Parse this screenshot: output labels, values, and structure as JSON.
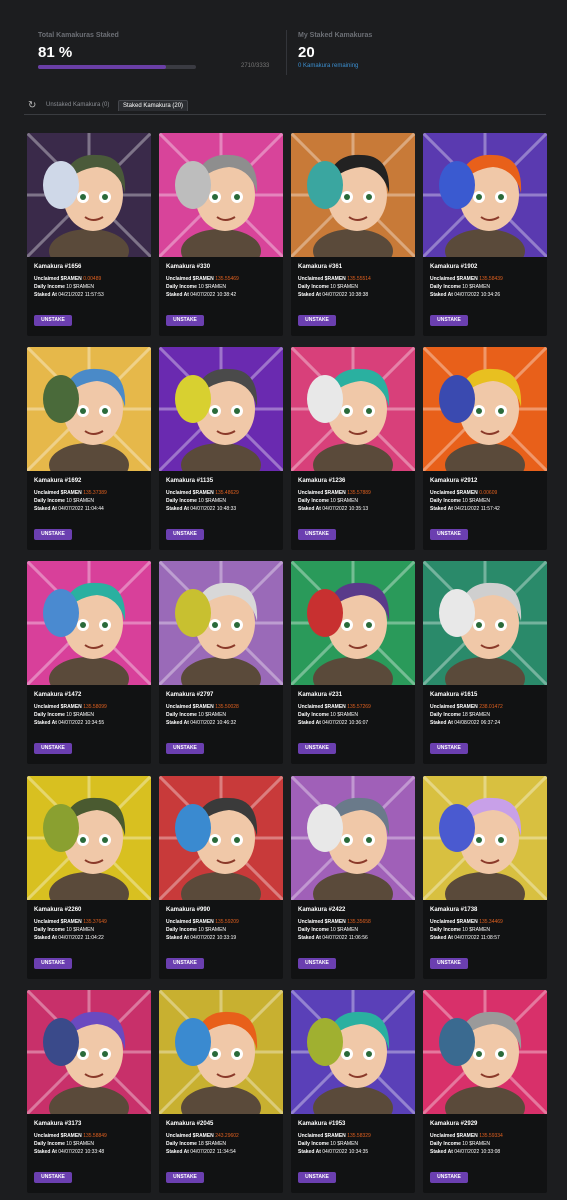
{
  "stats": {
    "total_label": "Total Kamakuras Staked",
    "total_percent": "81 %",
    "progress_fraction": 0.81,
    "progress_count": "2710/3333",
    "my_label": "My Staked Kamakuras",
    "my_count": "20",
    "remaining": "0 Kamakura remaining"
  },
  "tabs": {
    "refresh_icon": "refresh-icon",
    "unstaked": "Unstaked Kamakura (0)",
    "staked": "Staked Kamakura (20)"
  },
  "labels": {
    "unclaimed": "Unclaimed $RAMEN",
    "daily": "Daily Income",
    "staked_at": "Staked At",
    "button": "UNSTAKE"
  },
  "colors": {
    "accent_purple": "#6b3fb0",
    "value_orange": "#e0601f",
    "link_blue": "#3b8fd0"
  },
  "cards": [
    {
      "name": "Kamakura #1656",
      "unclaimed": "0.00489",
      "daily": "10 $RAMEN",
      "staked": "04/21/2022 11:57:53",
      "bg": "#3a2a4a",
      "mask": "#cfd8e8",
      "hair": "#4a5a3a"
    },
    {
      "name": "Kamakura #330",
      "unclaimed": "135.55469",
      "daily": "10 $RAMEN",
      "staked": "04/07/2022 10:38:42",
      "bg": "#d8449a",
      "mask": "#bdbdbd",
      "hair": "#8e8e8e"
    },
    {
      "name": "Kamakura #361",
      "unclaimed": "135.55514",
      "daily": "10 $RAMEN",
      "staked": "04/07/2022 10:38:38",
      "bg": "#c87a38",
      "mask": "#3aa6a0",
      "hair": "#222222"
    },
    {
      "name": "Kamakura #1902",
      "unclaimed": "135.58439",
      "daily": "10 $RAMEN",
      "staked": "04/07/2022 10:34:26",
      "bg": "#5a3ab0",
      "mask": "#3a5ad0",
      "hair": "#e8601a"
    },
    {
      "name": "Kamakura #1692",
      "unclaimed": "135.37389",
      "daily": "10 $RAMEN",
      "staked": "04/07/2022 11:04:44",
      "bg": "#e6b84a",
      "mask": "#4a6a3a",
      "hair": "#4a8ac8"
    },
    {
      "name": "Kamakura #1135",
      "unclaimed": "135.48629",
      "daily": "10 $RAMEN",
      "staked": "04/07/2022 10:48:33",
      "bg": "#6a2ab0",
      "mask": "#d8d030",
      "hair": "#4a4a4a"
    },
    {
      "name": "Kamakura #1236",
      "unclaimed": "135.57889",
      "daily": "10 $RAMEN",
      "staked": "04/07/2022 10:35:13",
      "bg": "#d8407a",
      "mask": "#e8e8e8",
      "hair": "#2ab0a0"
    },
    {
      "name": "Kamakura #2912",
      "unclaimed": "0.00609",
      "daily": "10 $RAMEN",
      "staked": "04/21/2022 11:57:42",
      "bg": "#e8601a",
      "mask": "#3a4ab0",
      "hair": "#e8c020"
    },
    {
      "name": "Kamakura #1472",
      "unclaimed": "135.58099",
      "daily": "10 $RAMEN",
      "staked": "04/07/2022 10:34:55",
      "bg": "#d8409a",
      "mask": "#4a8ad0",
      "hair": "#2ab0a0"
    },
    {
      "name": "Kamakura #2797",
      "unclaimed": "135.50028",
      "daily": "10 $RAMEN",
      "staked": "04/07/2022 10:46:32",
      "bg": "#9a6ab8",
      "mask": "#c8c030",
      "hair": "#d8d8d8"
    },
    {
      "name": "Kamakura #231",
      "unclaimed": "135.57269",
      "daily": "10 $RAMEN",
      "staked": "04/07/2022 10:36:07",
      "bg": "#2a9a5a",
      "mask": "#c83030",
      "hair": "#5a3a8a"
    },
    {
      "name": "Kamakura #1615",
      "unclaimed": "238.01472",
      "daily": "18 $RAMEN",
      "staked": "04/08/2022 06:37:24",
      "bg": "#2a8a6a",
      "mask": "#e8e8e8",
      "hair": "#cfcfcf"
    },
    {
      "name": "Kamakura #2260",
      "unclaimed": "135.37649",
      "daily": "10 $RAMEN",
      "staked": "04/07/2022 11:04:22",
      "bg": "#d8c020",
      "mask": "#8aa030",
      "hair": "#4a5a30"
    },
    {
      "name": "Kamakura #990",
      "unclaimed": "135.59209",
      "daily": "10 $RAMEN",
      "staked": "04/07/2022 10:33:19",
      "bg": "#c83a3a",
      "mask": "#3a8ad0",
      "hair": "#3a3a3a"
    },
    {
      "name": "Kamakura #2422",
      "unclaimed": "135.35658",
      "daily": "10 $RAMEN",
      "staked": "04/07/2022 11:06:56",
      "bg": "#a060b8",
      "mask": "#e8e8e8",
      "hair": "#6a7a8a"
    },
    {
      "name": "Kamakura #1738",
      "unclaimed": "135.34469",
      "daily": "10 $RAMEN",
      "staked": "04/07/2022 11:08:57",
      "bg": "#d8c040",
      "mask": "#4a5ad0",
      "hair": "#c8a0e8"
    },
    {
      "name": "Kamakura #3173",
      "unclaimed": "135.58849",
      "daily": "10 $RAMEN",
      "staked": "04/07/2022 10:33:48",
      "bg": "#c8306a",
      "mask": "#3a4a8a",
      "hair": "#6a4ac0"
    },
    {
      "name": "Kamakura #2045",
      "unclaimed": "243.29602",
      "daily": "18 $RAMEN",
      "staked": "04/07/2022 11:34:54",
      "bg": "#c8b030",
      "mask": "#3a8ad0",
      "hair": "#e8601a"
    },
    {
      "name": "Kamakura #1953",
      "unclaimed": "135.58329",
      "daily": "10 $RAMEN",
      "staked": "04/07/2022 10:34:35",
      "bg": "#5a40b8",
      "mask": "#a0b030",
      "hair": "#2ab0a0"
    },
    {
      "name": "Kamakura #2929",
      "unclaimed": "135.59334",
      "daily": "10 $RAMEN",
      "staked": "04/07/2022 10:33:08",
      "bg": "#d8306a",
      "mask": "#3a6a90",
      "hair": "#9a9a9a"
    }
  ]
}
